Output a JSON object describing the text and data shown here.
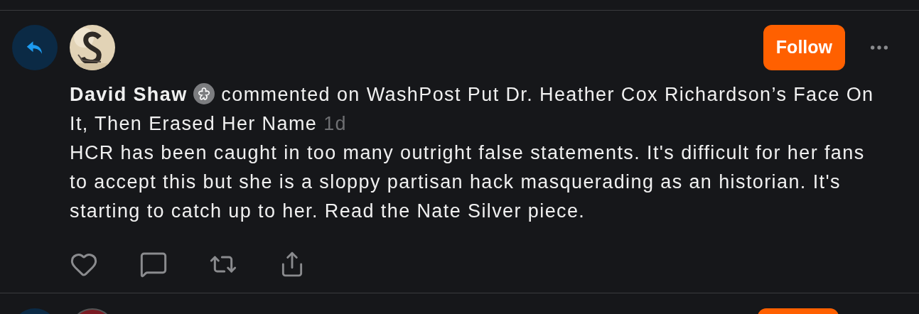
{
  "post": {
    "author": "David Shaw",
    "action": "commented on WashPost Put Dr. Heather Cox Richardson’s Face On It, Then Erased Her Name",
    "time": "1d",
    "body": "HCR has been caught in too many outright false statements. It's difficult for her fans to accept this but she is a sloppy partisan hack masquerading as an historian. It's starting to catch up to her. Read the Nate Silver piece.",
    "follow_button": "Follow"
  }
}
